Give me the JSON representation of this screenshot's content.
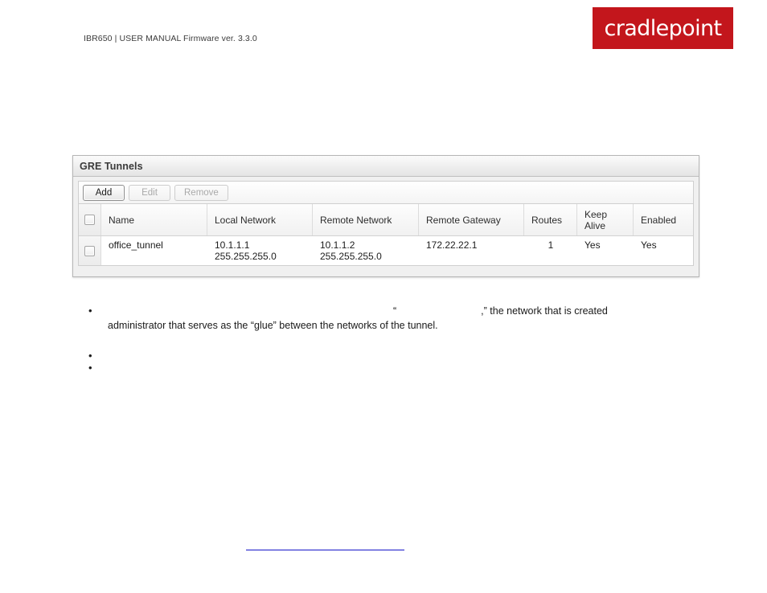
{
  "page": {
    "header_text": "IBR650 | USER MANUAL Firmware ver. 3.3.0",
    "brand": "cradlepoint",
    "brand_color": "#c3161c"
  },
  "panel": {
    "title": "GRE Tunnels",
    "toolbar": {
      "add_label": "Add",
      "edit_label": "Edit",
      "remove_label": "Remove"
    },
    "table": {
      "columns": [
        {
          "key": "select",
          "label": ""
        },
        {
          "key": "name",
          "label": "Name"
        },
        {
          "key": "local",
          "label": "Local Network"
        },
        {
          "key": "remote",
          "label": "Remote Network"
        },
        {
          "key": "gateway",
          "label": "Remote Gateway"
        },
        {
          "key": "routes",
          "label": "Routes"
        },
        {
          "key": "keep",
          "label": "Keep\nAlive"
        },
        {
          "key": "enabled",
          "label": "Enabled"
        }
      ],
      "keep_alive_line1": "Keep",
      "keep_alive_line2": "Alive",
      "rows": [
        {
          "name": "office_tunnel",
          "local_ip": "10.1.1.1",
          "local_mask": "255.255.255.0",
          "remote_ip": "10.1.1.2",
          "remote_mask": "255.255.255.0",
          "gateway": "172.22.22.1",
          "routes": "1",
          "keep_alive": "Yes",
          "enabled": "Yes"
        }
      ]
    }
  },
  "body": {
    "bullets": [
      {
        "line1_quote": "“",
        "line1_tail": ",” the network that is created",
        "line2": "administrator that serves as the “glue” between the networks of the tunnel."
      },
      {
        "line1_quote": "",
        "line1_tail": "",
        "line2": ""
      },
      {
        "line1_quote": "",
        "line1_tail": "",
        "line2": ""
      }
    ]
  }
}
